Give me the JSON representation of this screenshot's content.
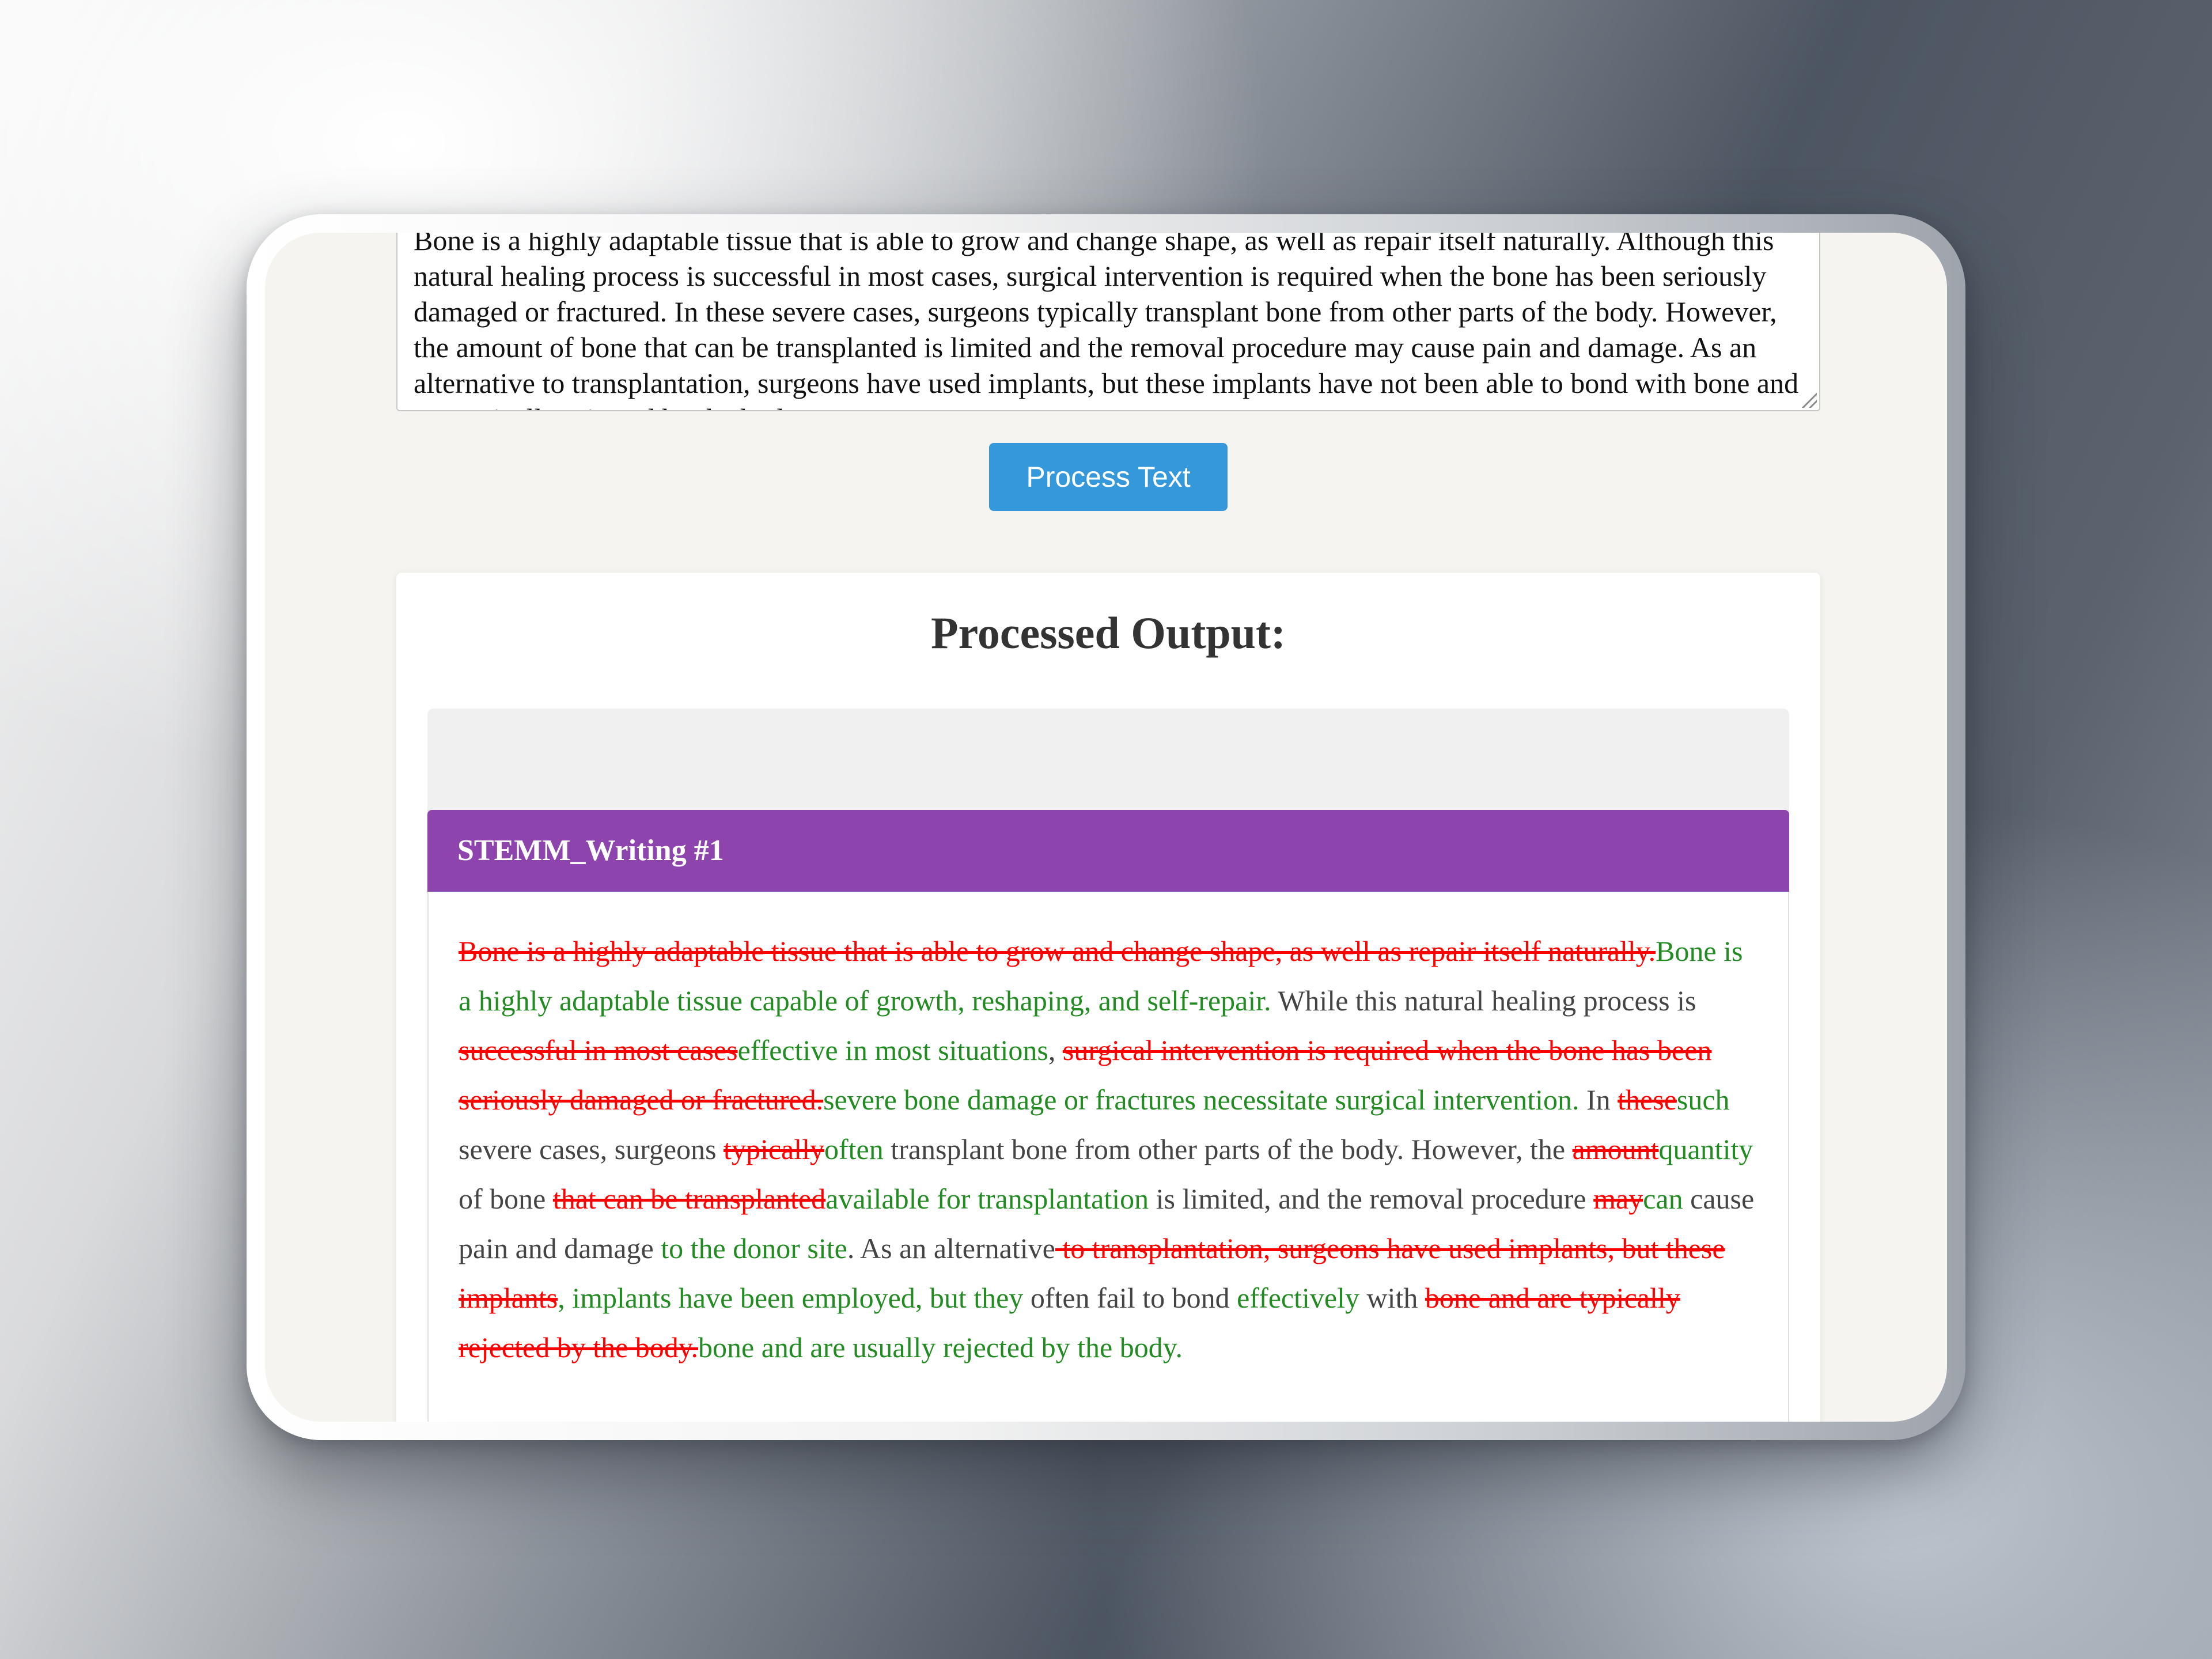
{
  "input": {
    "text": "Bone is a highly adaptable tissue that is able to grow and change shape, as well as repair itself naturally. Although this natural healing process is successful in most cases, surgical intervention is required when the bone has been seriously damaged or fractured. In these severe cases, surgeons typically transplant bone from other parts of the body. However, the amount of bone that can be transplanted is limited and the removal procedure may cause pain and damage. As an alternative to transplantation, surgeons have used implants, but these implants have not been able to bond with bone and are typically rejected by the body."
  },
  "process_button": {
    "label": "Process Text"
  },
  "output": {
    "title": "Processed Output:",
    "panel": {
      "header": "STEMM_Writing #1",
      "segments": [
        {
          "type": "del",
          "text": "Bone is a highly adaptable tissue that is able to grow and change shape, as well as repair itself naturally."
        },
        {
          "type": "ins",
          "text": "Bone is a highly adaptable tissue capable of growth, reshaping, and self-repair."
        },
        {
          "type": "eq",
          "text": " While this natural healing process is "
        },
        {
          "type": "del",
          "text": "successful in most cases"
        },
        {
          "type": "ins",
          "text": "effective in most situations"
        },
        {
          "type": "eq",
          "text": ", "
        },
        {
          "type": "del",
          "text": "surgical intervention is required when the bone has been seriously damaged or fractured."
        },
        {
          "type": "ins",
          "text": "severe bone damage or fractures necessitate surgical intervention."
        },
        {
          "type": "eq",
          "text": " In "
        },
        {
          "type": "del",
          "text": "these"
        },
        {
          "type": "ins",
          "text": "such"
        },
        {
          "type": "eq",
          "text": " severe cases, surgeons "
        },
        {
          "type": "del",
          "text": "typically"
        },
        {
          "type": "ins",
          "text": "often"
        },
        {
          "type": "eq",
          "text": " transplant bone from other parts of the body. However, the "
        },
        {
          "type": "del",
          "text": "amount"
        },
        {
          "type": "ins",
          "text": "quantity"
        },
        {
          "type": "eq",
          "text": " of bone "
        },
        {
          "type": "del",
          "text": "that can be transplanted"
        },
        {
          "type": "ins",
          "text": "available for transplantation"
        },
        {
          "type": "eq",
          "text": " is limited, and the removal procedure "
        },
        {
          "type": "del",
          "text": "may"
        },
        {
          "type": "ins",
          "text": "can"
        },
        {
          "type": "eq",
          "text": " cause pain and damage "
        },
        {
          "type": "ins",
          "text": "to the donor site"
        },
        {
          "type": "eq",
          "text": ". As an alternative"
        },
        {
          "type": "del",
          "text": " to transplantation, surgeons have used implants, but these implants"
        },
        {
          "type": "ins",
          "text": ", implants have been employed, but they"
        },
        {
          "type": "eq",
          "text": " often fail to bond "
        },
        {
          "type": "ins",
          "text": "effectively"
        },
        {
          "type": "eq",
          "text": " with "
        },
        {
          "type": "del",
          "text": "bone and are typically rejected by the body."
        },
        {
          "type": "ins",
          "text": "bone and are usually rejected by the body."
        }
      ]
    }
  }
}
